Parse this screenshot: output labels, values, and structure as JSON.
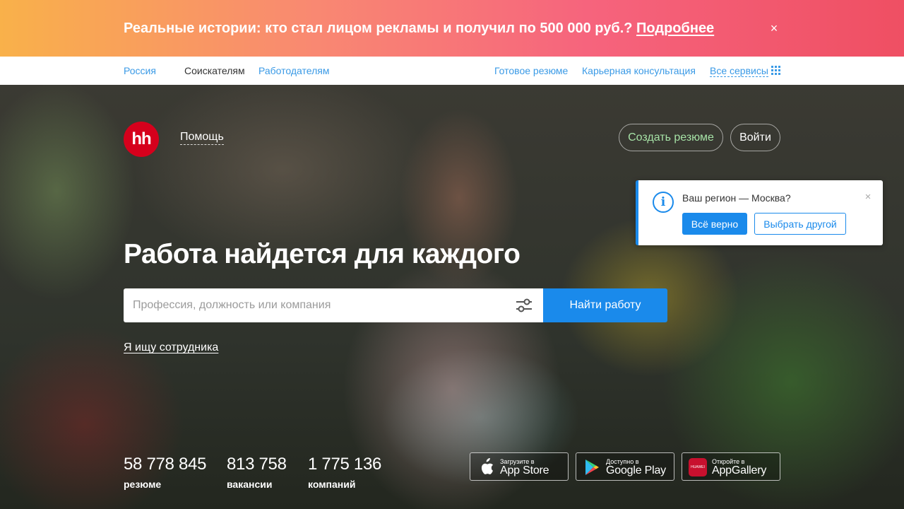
{
  "promo": {
    "text": "Реальные истории: кто стал лицом рекламы и получил по 500 000 руб.?",
    "link": "Подробнее",
    "close": "×"
  },
  "topnav": {
    "region": "Россия",
    "seekers": "Соискателям",
    "employers": "Работодателям",
    "ready_resume": "Готовое резюме",
    "career": "Карьерная консультация",
    "all_services": "Все сервисы"
  },
  "header": {
    "logo": "hh",
    "help": "Помощь",
    "create_resume": "Создать резюме",
    "login": "Войти"
  },
  "region_popup": {
    "icon": "i",
    "question": "Ваш регион — Москва?",
    "confirm": "Всё верно",
    "choose_other": "Выбрать другой",
    "close": "×"
  },
  "hero": {
    "headline": "Работа найдется для каждого",
    "search_placeholder": "Профессия, должность или компания",
    "search_button": "Найти работу",
    "employer_link": "Я ищу сотрудника"
  },
  "stats": [
    {
      "value": "58 778 845",
      "label": "резюме"
    },
    {
      "value": "813 758",
      "label": "вакансии"
    },
    {
      "value": "1 775 136",
      "label": "компаний"
    }
  ],
  "apps": [
    {
      "small": "Загрузите в",
      "big": "App Store",
      "icon": "apple-icon"
    },
    {
      "small": "Доступно в",
      "big": "Google Play",
      "icon": "google-play-icon"
    },
    {
      "small": "Откройте в",
      "big": "AppGallery",
      "icon": "huawei-icon",
      "icon_text": "HUAWEI"
    }
  ],
  "colors": {
    "accent": "#1a8aeb",
    "logo_red": "#d6001c",
    "link_blue": "#3a9ae6",
    "create_resume_green": "#a6e2a6"
  }
}
